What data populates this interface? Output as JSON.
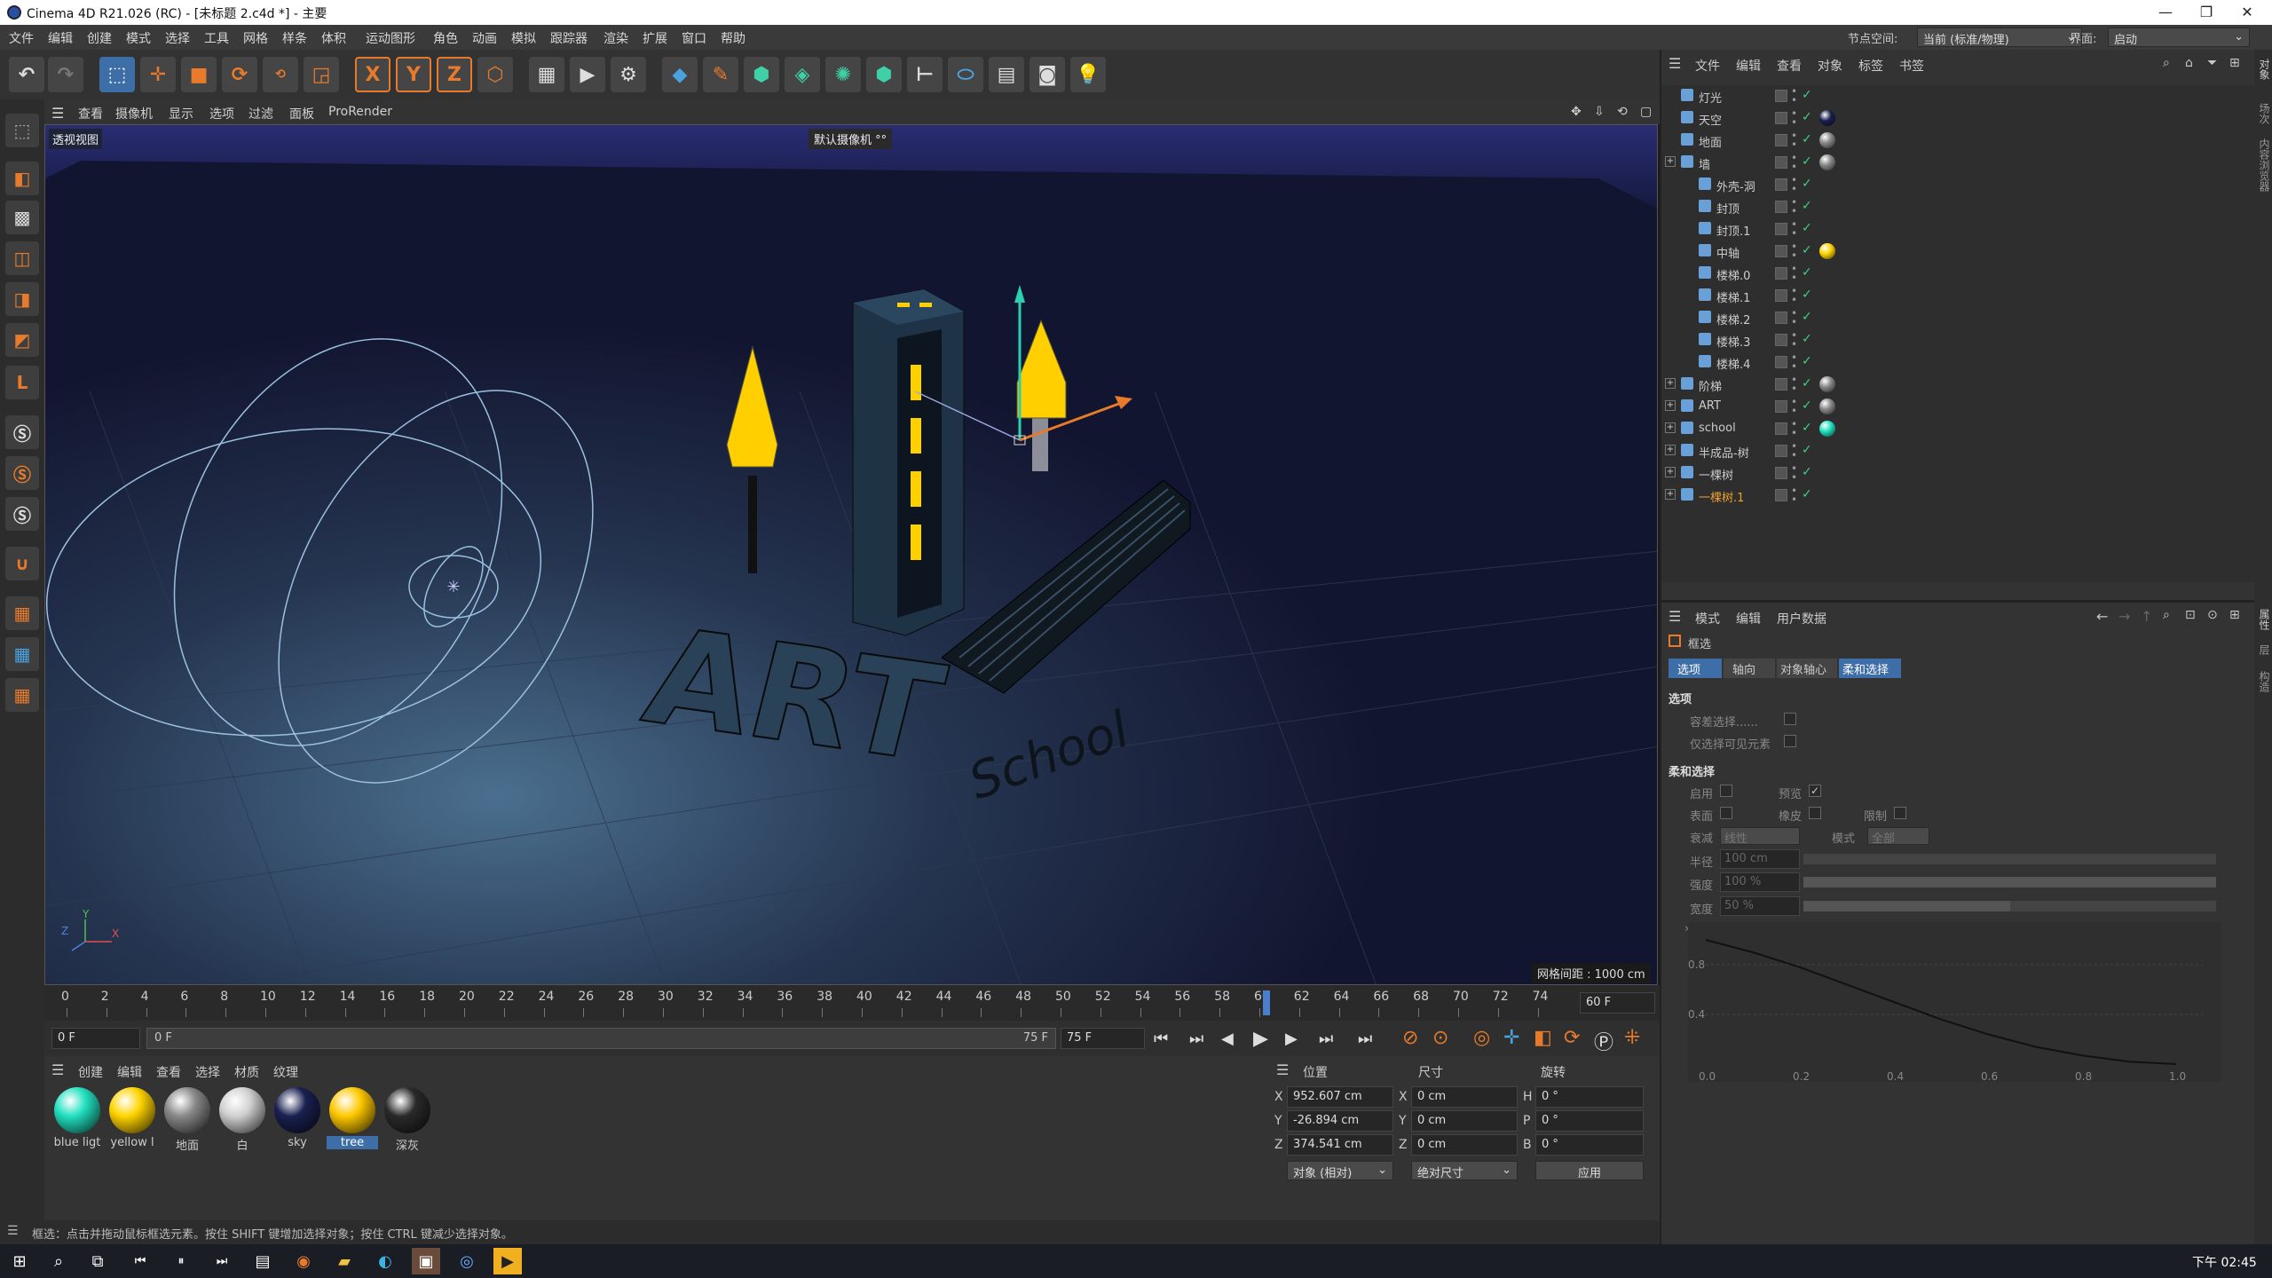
{
  "window": {
    "title": "Cinema 4D R21.026 (RC) - [未标题 2.c4d *] - 主要",
    "min": "—",
    "max": "❐",
    "close": "✕"
  },
  "menu": [
    "文件",
    "编辑",
    "创建",
    "模式",
    "选择",
    "工具",
    "网格",
    "样条",
    "体积",
    "运动图形",
    "角色",
    "动画",
    "模拟",
    "跟踪器",
    "渲染",
    "扩展",
    "窗口",
    "帮助"
  ],
  "node": {
    "label": "节点空间:",
    "value": "当前 (标准/物理)",
    "layout_label": "界面:",
    "layout_value": "启动"
  },
  "toolbar": {
    "x": "X",
    "y": "Y",
    "z": "Z"
  },
  "viewport": {
    "menus": [
      "查看",
      "摄像机",
      "显示",
      "选项",
      "过滤",
      "面板",
      "ProRender"
    ],
    "label": "透视视图",
    "camera": "默认摄像机 °°",
    "grid": "网格间距 : 1000 cm",
    "axis_x": "X",
    "axis_y": "Y",
    "axis_z": "Z",
    "text3d_big": "ART",
    "text3d_small": "School"
  },
  "timeline": {
    "ticks": [
      "0",
      "2",
      "4",
      "6",
      "8",
      "10",
      "12",
      "14",
      "16",
      "18",
      "20",
      "22",
      "24",
      "26",
      "28",
      "30",
      "32",
      "34",
      "36",
      "38",
      "40",
      "42",
      "44",
      "46",
      "48",
      "50",
      "52",
      "54",
      "56",
      "58",
      "60",
      "62",
      "64",
      "66",
      "68",
      "70",
      "72",
      "74"
    ],
    "end_field": "60 F",
    "current": 60,
    "start": "0 F",
    "range_start": "0 F",
    "range_end": "75 F",
    "end": "75 F"
  },
  "materials": {
    "menus": [
      "创建",
      "编辑",
      "查看",
      "选择",
      "材质",
      "纹理"
    ],
    "items": [
      {
        "name": "blue ligt",
        "color": "#22e0c0"
      },
      {
        "name": "yellow l",
        "color": "#ffd400"
      },
      {
        "name": "地面",
        "color": "#888888"
      },
      {
        "name": "白",
        "color": "#d0d0d0"
      },
      {
        "name": "sky",
        "color": "#1a2050"
      },
      {
        "name": "tree",
        "color": "#ffc800"
      },
      {
        "name": "深灰",
        "color": "#2a2a2a"
      }
    ],
    "selected": "tree"
  },
  "coords": {
    "heads": [
      "位置",
      "尺寸",
      "旋转"
    ],
    "rows": [
      {
        "a": "X",
        "pos": "952.607 cm",
        "b": "X",
        "size": "0 cm",
        "c": "H",
        "rot": "0 °"
      },
      {
        "a": "Y",
        "pos": "-26.894 cm",
        "b": "Y",
        "size": "0 cm",
        "c": "P",
        "rot": "0 °"
      },
      {
        "a": "Z",
        "pos": "374.541 cm",
        "b": "Z",
        "size": "0 cm",
        "c": "B",
        "rot": "0 °"
      }
    ],
    "mode1": "对象 (相对)",
    "mode2": "绝对尺寸",
    "apply": "应用"
  },
  "status": "框选：点击并拖动鼠标框选元素。按住 SHIFT 键增加选择对象；按住 CTRL 键减少选择对象。",
  "clock": "下午 02:45",
  "objects": {
    "menus": [
      "文件",
      "编辑",
      "查看",
      "对象",
      "标签",
      "书签"
    ],
    "items": [
      {
        "name": "灯光",
        "indent": 0,
        "tag": ""
      },
      {
        "name": "天空",
        "indent": 0,
        "tag": "#1a2050"
      },
      {
        "name": "地面",
        "indent": 0,
        "tag": "#888888"
      },
      {
        "name": "墙",
        "indent": 0,
        "tag": "#888888"
      },
      {
        "name": "外壳-洞",
        "indent": 1,
        "tag": ""
      },
      {
        "name": "封顶",
        "indent": 1,
        "tag": ""
      },
      {
        "name": "封顶.1",
        "indent": 1,
        "tag": ""
      },
      {
        "name": "中轴",
        "indent": 1,
        "tag": "#ffd400"
      },
      {
        "name": "楼梯.0",
        "indent": 1,
        "tag": ""
      },
      {
        "name": "楼梯.1",
        "indent": 1,
        "tag": ""
      },
      {
        "name": "楼梯.2",
        "indent": 1,
        "tag": ""
      },
      {
        "name": "楼梯.3",
        "indent": 1,
        "tag": ""
      },
      {
        "name": "楼梯.4",
        "indent": 1,
        "tag": ""
      },
      {
        "name": "阶梯",
        "indent": 0,
        "tag": "#888888"
      },
      {
        "name": "ART",
        "indent": 0,
        "tag": "#888888"
      },
      {
        "name": "school",
        "indent": 0,
        "tag": "#22e0c0"
      },
      {
        "name": "半成品-树",
        "indent": 0,
        "tag": ""
      },
      {
        "name": "一棵树",
        "indent": 0,
        "tag": ""
      },
      {
        "name": "一棵树.1",
        "indent": 0,
        "tag": "",
        "highlight": true
      }
    ]
  },
  "attrs": {
    "menus": [
      "模式",
      "编辑",
      "用户数据"
    ],
    "title": "框选",
    "tabs": [
      "选项",
      "轴向",
      "对象轴心",
      "柔和选择"
    ],
    "options": "选项",
    "tolerant": "容差选择......",
    "visible_only": "仅选择可见元素",
    "soft": "柔和选择",
    "enable": "启用",
    "preview": "预览",
    "surface": "表面",
    "rubber": "橡皮",
    "limit": "限制",
    "falloff": "衰减",
    "falloff_val": "线性",
    "mode": "模式",
    "mode_val": "全部",
    "radius": "半径",
    "radius_val": "100 cm",
    "strength": "强度",
    "strength_val": "100 %",
    "width": "宽度",
    "width_val": "50 %",
    "graph_y": [
      "0.8",
      "0.4"
    ],
    "graph_x": [
      "0.0",
      "0.2",
      "0.4",
      "0.6",
      "0.8",
      "1.0"
    ],
    "curve": [
      [
        0,
        1
      ],
      [
        0.1,
        0.9
      ],
      [
        0.2,
        0.78
      ],
      [
        0.3,
        0.64
      ],
      [
        0.4,
        0.5
      ],
      [
        0.5,
        0.36
      ],
      [
        0.6,
        0.24
      ],
      [
        0.7,
        0.14
      ],
      [
        0.8,
        0.07
      ],
      [
        0.9,
        0.02
      ],
      [
        1,
        0
      ]
    ]
  },
  "side_tabs": [
    "对象",
    "场次",
    "内容浏览器"
  ],
  "side_tabs2": [
    "属性",
    "层",
    "构造"
  ]
}
